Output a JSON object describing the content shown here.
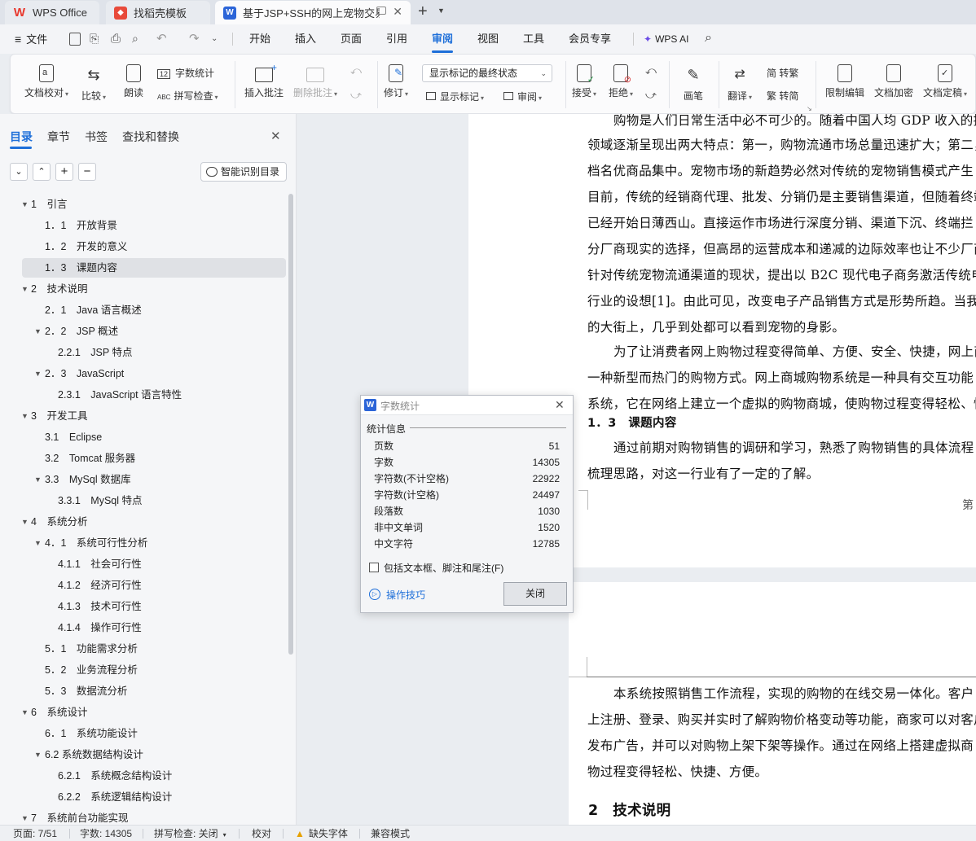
{
  "tabs": [
    {
      "label": "WPS Office",
      "icon": "wps-logo-icon"
    },
    {
      "label": "找稻壳模板",
      "icon": "docer-icon"
    },
    {
      "label": "基于JSP+SSH的网上宠物交易",
      "icon": "word-doc-icon"
    }
  ],
  "menu": {
    "file": "文件",
    "items": [
      "开始",
      "插入",
      "页面",
      "引用",
      "审阅",
      "视图",
      "工具",
      "会员专享"
    ],
    "active": "审阅",
    "ai": "WPS AI"
  },
  "ribbon": {
    "doc_check": "文档校对",
    "compare": "比较",
    "read": "朗读",
    "word_count": "字数统计",
    "spell": "拼写检查",
    "insert_comment": "插入批注",
    "delete_comment": "删除批注",
    "revise": "修订",
    "markup_state": "显示标记的最终状态",
    "show_markup": "显示标记",
    "review": "审阅",
    "accept": "接受",
    "reject": "拒绝",
    "pen": "画笔",
    "translate": "翻译",
    "trad": "简 转繁",
    "simp": "繁 转简",
    "restrict": "限制编辑",
    "encrypt": "文档加密",
    "finalize": "文档定稿"
  },
  "panel": {
    "tabs": [
      "目录",
      "章节",
      "书签",
      "查找和替换"
    ],
    "smart_button": "智能识别目录",
    "toc": [
      {
        "label": "1　引言",
        "level": 1,
        "tri": "down"
      },
      {
        "label": "1．1　开放背景",
        "level": 2
      },
      {
        "label": "1．2　开发的意义",
        "level": 2
      },
      {
        "label": "1．3　课题内容",
        "level": 2,
        "selected": true
      },
      {
        "label": "2　技术说明",
        "level": 1,
        "tri": "down"
      },
      {
        "label": "2．1　Java 语言概述",
        "level": 2
      },
      {
        "label": "2．2　JSP 概述",
        "level": 2,
        "tri": "down"
      },
      {
        "label": "2.2.1　JSP 特点",
        "level": 3
      },
      {
        "label": "2．3　JavaScript",
        "level": 2,
        "tri": "down"
      },
      {
        "label": "2.3.1　JavaScript 语言特性",
        "level": 3
      },
      {
        "label": "3　开发工具",
        "level": 1,
        "tri": "down"
      },
      {
        "label": "3.1　Eclipse",
        "level": 2
      },
      {
        "label": "3.2　Tomcat 服务器",
        "level": 2
      },
      {
        "label": "3.3　MySql 数据库",
        "level": 2,
        "tri": "down"
      },
      {
        "label": "3.3.1　MySql 特点",
        "level": 3
      },
      {
        "label": "4　系统分析",
        "level": 1,
        "tri": "down"
      },
      {
        "label": "4．1　系统可行性分析",
        "level": 2,
        "tri": "down"
      },
      {
        "label": "4.1.1　社会可行性",
        "level": 3
      },
      {
        "label": "4.1.2　经济可行性",
        "level": 3
      },
      {
        "label": "4.1.3　技术可行性",
        "level": 3
      },
      {
        "label": "4.1.4　操作可行性",
        "level": 3
      },
      {
        "label": "5．1　功能需求分析",
        "level": 2
      },
      {
        "label": "5．2　业务流程分析",
        "level": 2
      },
      {
        "label": "5．3　数据流分析",
        "level": 2
      },
      {
        "label": "6　系统设计",
        "level": 1,
        "tri": "down"
      },
      {
        "label": "6．1　系统功能设计",
        "level": 2
      },
      {
        "label": "6.2 系统数据结构设计",
        "level": 2,
        "tri": "down"
      },
      {
        "label": "6.2.1　系统概念结构设计",
        "level": 3
      },
      {
        "label": "6.2.2　系统逻辑结构设计",
        "level": 3
      },
      {
        "label": "7　系统前台功能实现",
        "level": 1,
        "tri": "down"
      }
    ]
  },
  "doc": {
    "page1": [
      "购物是人们日常生活中必不可少的。随着中国人均 GDP 收入的提高，",
      "领域逐渐呈现出两大特点：第一，购物流通市场总量迅速扩大；第二，市",
      "档名优商品集中。宠物市场的新趋势必然对传统的宠物销售模式产生",
      "目前，传统的经销商代理、批发、分销仍是主要销售渠道，但随着终端",
      "已经开始日薄西山。直接运作市场进行深度分销、渠道下沉、终端拦",
      "分厂商现实的选择，但高昂的运营成本和递减的边际效率也让不少厂商",
      "针对传统宠物流通渠道的现状，提出以 B2C 现代电子商务激活传统电",
      "行业的设想[1]。由此可见，改变电子产品销售方式是形势所趋。当我",
      "的大街上，几乎到处都可以看到宠物的身影。",
      "为了让消费者网上购物过程变得简单、方便、安全、快捷，网上商",
      "一种新型而热门的购物方式。网上商城购物系统是一种具有交互功能",
      "系统，它在网络上建立一个虚拟的购物商城，使购物过程变得轻松、快"
    ],
    "heading13": "1．3　课题内容",
    "page1b": [
      "通过前期对购物销售的调研和学习，熟悉了购物销售的具体流程",
      "梳理思路，对这一行业有了一定的了解。"
    ],
    "page_marker": "第",
    "page2": [
      "本系统按照销售工作流程，实现的购物的在线交易一体化。客户",
      "上注册、登录、购买并实时了解购物价格变动等功能，商家可以对客户",
      "发布广告，并可以对购物上架下架等操作。通过在网络上搭建虚拟商",
      "物过程变得轻松、快捷、方便。"
    ],
    "heading2": "2　技术说明"
  },
  "dialog": {
    "title": "字数统计",
    "section": "统计信息",
    "rows": [
      {
        "label": "页数",
        "value": "51"
      },
      {
        "label": "字数",
        "value": "14305"
      },
      {
        "label": "字符数(不计空格)",
        "value": "22922"
      },
      {
        "label": "字符数(计空格)",
        "value": "24497"
      },
      {
        "label": "段落数",
        "value": "1030"
      },
      {
        "label": "非中文单词",
        "value": "1520"
      },
      {
        "label": "中文字符",
        "value": "12785"
      }
    ],
    "checkbox": "包括文本框、脚注和尾注(F)",
    "tips": "操作技巧",
    "close": "关闭"
  },
  "status": {
    "page": "页面: 7/51",
    "words": "字数: 14305",
    "spell": "拼写检查: 关闭",
    "proof": "校对",
    "missing_font": "缺失字体",
    "compat": "兼容模式"
  },
  "colors": {
    "accent": "#1e6fd9",
    "wps_red": "#e8382d",
    "docer_red": "#e84a3a",
    "word_blue": "#2c65d8"
  }
}
